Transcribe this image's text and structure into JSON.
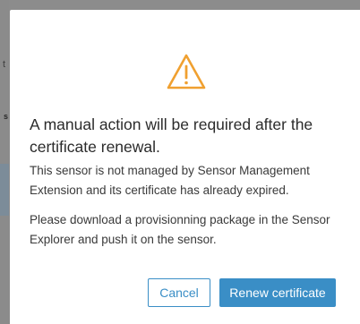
{
  "background": {
    "text_a": "t",
    "text_b": "s"
  },
  "dialog": {
    "icon": "warning-triangle-icon",
    "icon_color": "#f0a030",
    "title": "A manual action will be required after the certificate renewal.",
    "paragraph_1": "This sensor is not managed by Sensor Management Extension and its certificate has already expired.",
    "paragraph_2": "Please download a provisionning package in the Sensor Explorer and push it on the sensor.",
    "cancel_label": "Cancel",
    "renew_label": "Renew certificate",
    "accent_color": "#3a8ec6"
  }
}
